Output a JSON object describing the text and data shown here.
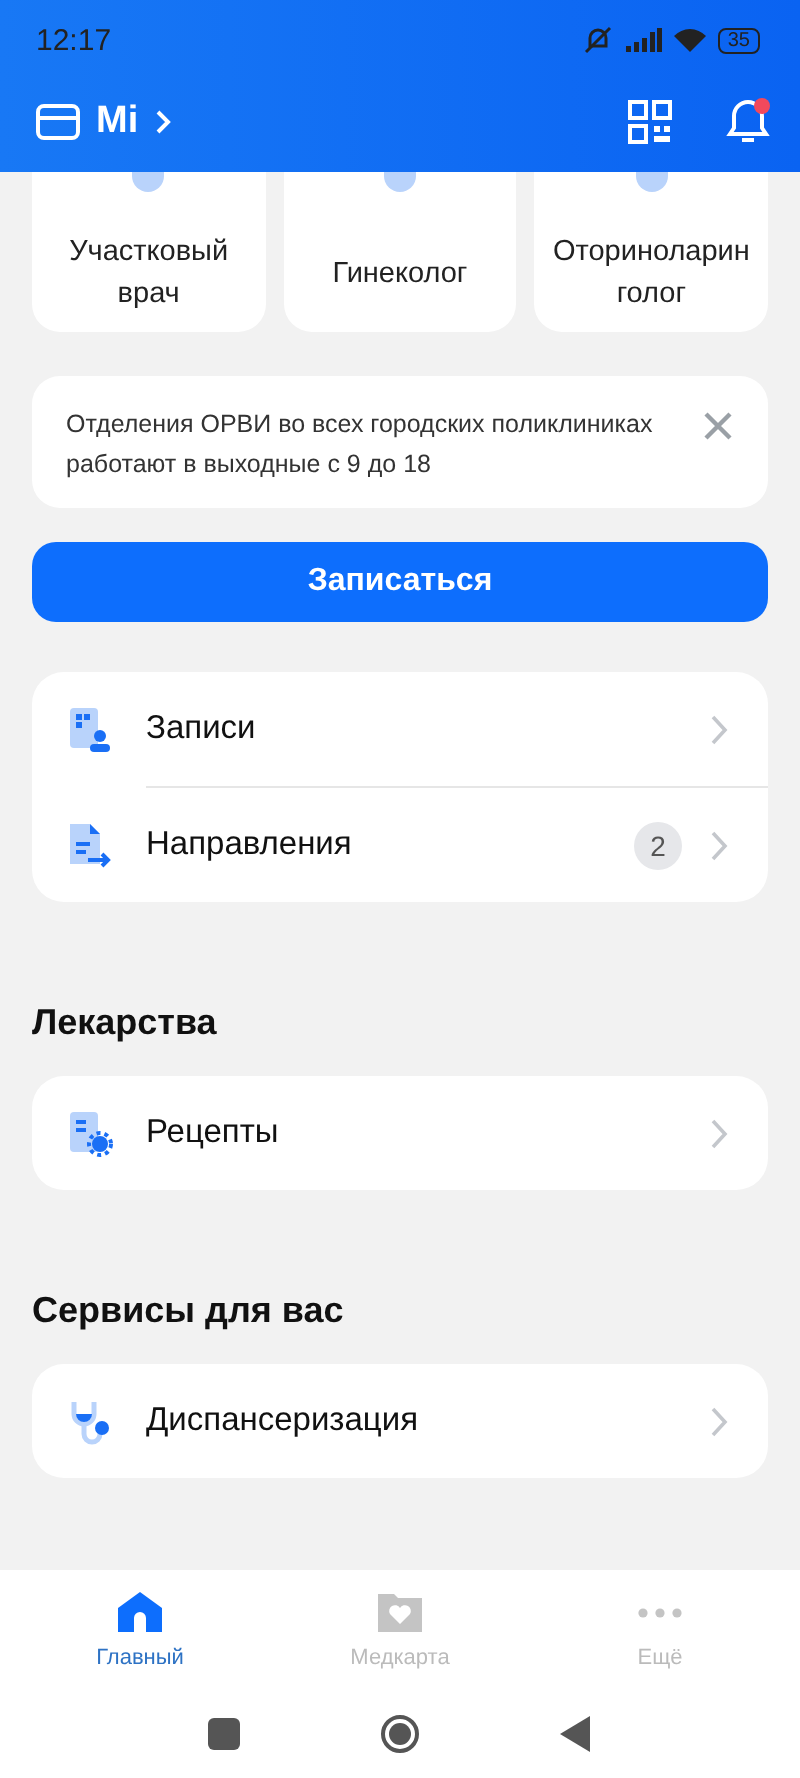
{
  "status_bar": {
    "time": "12:17",
    "battery": "35"
  },
  "header": {
    "title": "Mi",
    "has_notification": true
  },
  "doctors": [
    {
      "label": "Участковый врач"
    },
    {
      "label": "Гинеколог"
    },
    {
      "label": "Оториноларинголог"
    }
  ],
  "notice": {
    "text": "Отделения ОРВИ во всех городских поликлиниках работают в выходные с 9 до 18"
  },
  "primary_button": "Записаться",
  "main_list": [
    {
      "kind": "appointments",
      "label": "Записи"
    },
    {
      "kind": "referrals",
      "label": "Направления",
      "badge": "2"
    }
  ],
  "sections": [
    {
      "title": "Лекарства",
      "items": [
        {
          "kind": "prescriptions",
          "label": "Рецепты"
        }
      ]
    },
    {
      "title": "Сервисы для вас",
      "items": [
        {
          "kind": "checkup",
          "label": "Диспансеризация"
        }
      ]
    }
  ],
  "bottom_nav": [
    {
      "kind": "home",
      "label": "Главный",
      "selected": true
    },
    {
      "kind": "medcard",
      "label": "Медкарта",
      "selected": false
    },
    {
      "kind": "more",
      "label": "Ещё",
      "selected": false
    }
  ]
}
